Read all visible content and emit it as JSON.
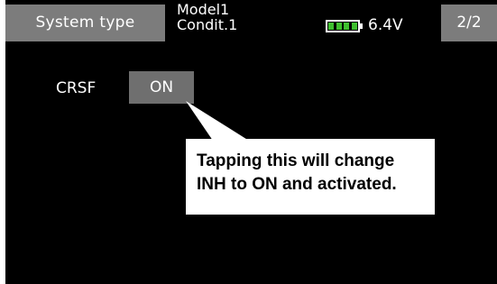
{
  "header": {
    "title": "System type",
    "model_name": "Model1",
    "condition": "Condit.1",
    "battery_voltage": "6.4V",
    "battery_icon": "battery-icon",
    "page_indicator": "2/2"
  },
  "settings": {
    "crsf_label": "CRSF",
    "crsf_value": "ON"
  },
  "callout": {
    "line1": "Tapping this will change",
    "line2": "INH to ON and activated."
  },
  "colors": {
    "screen_bg": "#000000",
    "header_box": "#7c7c7c",
    "button_bg": "#6f6f6f",
    "battery_fill": "#3fbf2f",
    "callout_bg": "#ffffff"
  }
}
